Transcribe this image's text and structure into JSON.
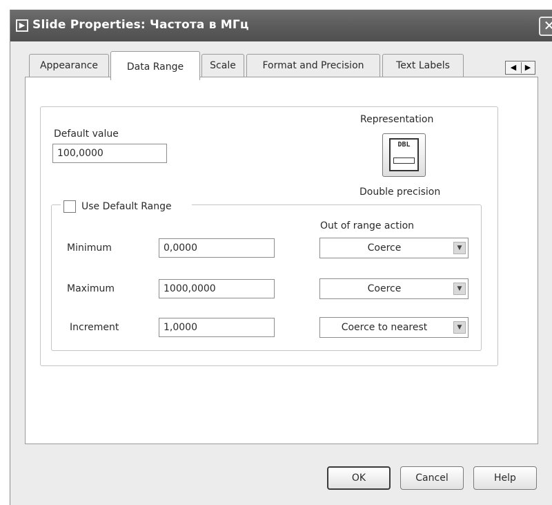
{
  "window": {
    "title": "Slide Properties: Частота в МГц",
    "close_glyph": "✕",
    "title_icon_glyph": "▶"
  },
  "tabs": [
    {
      "label": "Appearance",
      "active": false
    },
    {
      "label": "Data Range",
      "active": true
    },
    {
      "label": "Scale",
      "active": false
    },
    {
      "label": "Format and Precision",
      "active": false
    },
    {
      "label": "Text Labels",
      "active": false
    }
  ],
  "tab_scroll": {
    "left": "◀",
    "right": "▶"
  },
  "default_value": {
    "label": "Default value",
    "value": "100,0000"
  },
  "representation": {
    "label": "Representation",
    "icon_text": "DBL",
    "type": "Double precision"
  },
  "range": {
    "use_default_label": "Use Default Range",
    "use_default_checked": false,
    "out_of_range_header": "Out of range action",
    "rows": [
      {
        "label": "Minimum",
        "value": "0,0000",
        "action": "Coerce"
      },
      {
        "label": "Maximum",
        "value": "1000,0000",
        "action": "Coerce"
      },
      {
        "label": "Increment",
        "value": "1,0000",
        "action": "Coerce to nearest"
      }
    ]
  },
  "buttons": {
    "ok": "OK",
    "cancel": "Cancel",
    "help": "Help"
  },
  "dropdown_arrow": "▼"
}
